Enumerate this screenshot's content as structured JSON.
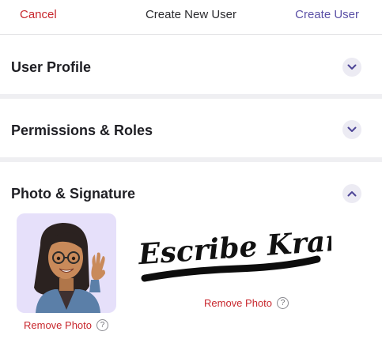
{
  "header": {
    "cancel_label": "Cancel",
    "title": "Create New User",
    "create_label": "Create User"
  },
  "sections": [
    {
      "title": "User Profile",
      "expanded": false
    },
    {
      "title": "Permissions & Roles",
      "expanded": false
    },
    {
      "title": "Photo & Signature",
      "expanded": true
    }
  ],
  "photo": {
    "remove_label": "Remove Photo",
    "help_symbol": "?"
  },
  "signature": {
    "text": "Escribe Kramer",
    "remove_label": "Remove Photo",
    "help_symbol": "?"
  },
  "icons": {
    "collapsed": "chevron-down-icon",
    "expanded": "chevron-up-icon",
    "help": "question-circle-icon"
  },
  "colors": {
    "danger": "#c8272d",
    "accent": "#5b50a6",
    "chevron_bg": "#ecebf3",
    "avatar_bg": "#e6e0fa",
    "section_band": "#efeff2"
  }
}
